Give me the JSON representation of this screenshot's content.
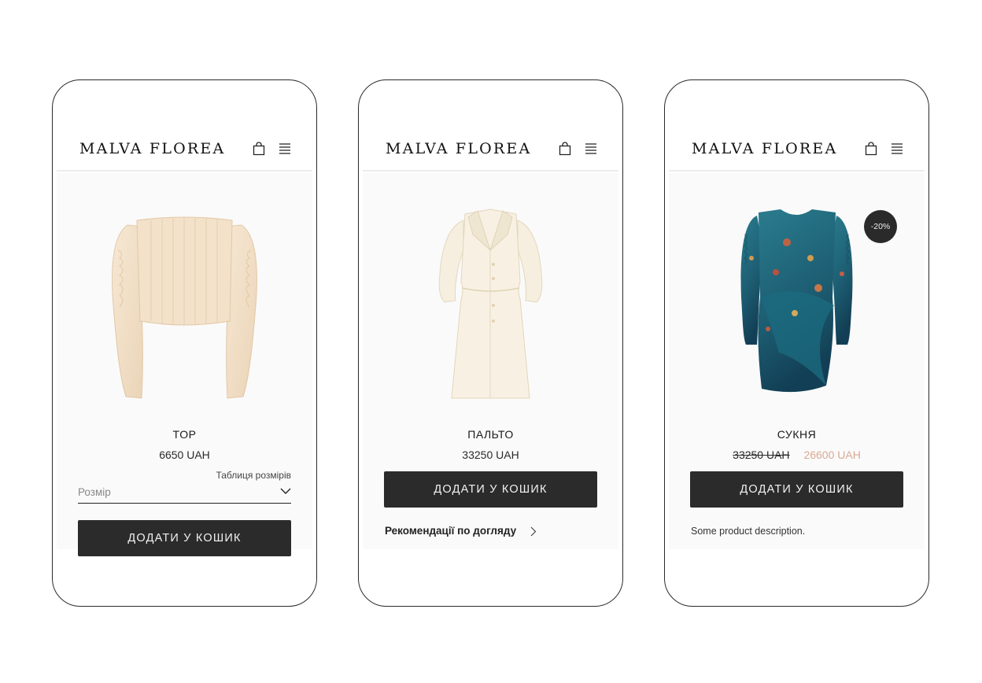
{
  "brand": {
    "logo_text": "MALVA FLOREA"
  },
  "header": {
    "bag_icon": "shopping-bag-icon",
    "menu_icon": "hamburger-menu-icon"
  },
  "screens": [
    {
      "product_name": "TOP",
      "price": "6650 UAH",
      "size_chart_label": "Таблиця розмірів",
      "size_placeholder": "Розмір",
      "add_to_cart_label": "ДОДАТИ У КОШИК",
      "image": "cream-ruched-sleeve-top"
    },
    {
      "product_name": "ПАЛЬТО",
      "price": "33250 UAH",
      "add_to_cart_label": "ДОДАТИ У КОШИК",
      "care_link_label": "Рекомендації по догляду",
      "image": "cream-long-coat"
    },
    {
      "product_name": "СУКНЯ",
      "old_price": "33250 UAH",
      "new_price": "26600 UAH",
      "discount_badge": "-20%",
      "add_to_cart_label": "ДОДАТИ У КОШИК",
      "description": "Some product description.",
      "image": "teal-floral-print-dress"
    }
  ],
  "colors": {
    "button_bg": "#2b2b2b",
    "sale_price": "#d9a994",
    "badge_bg": "#2a2a2a"
  }
}
